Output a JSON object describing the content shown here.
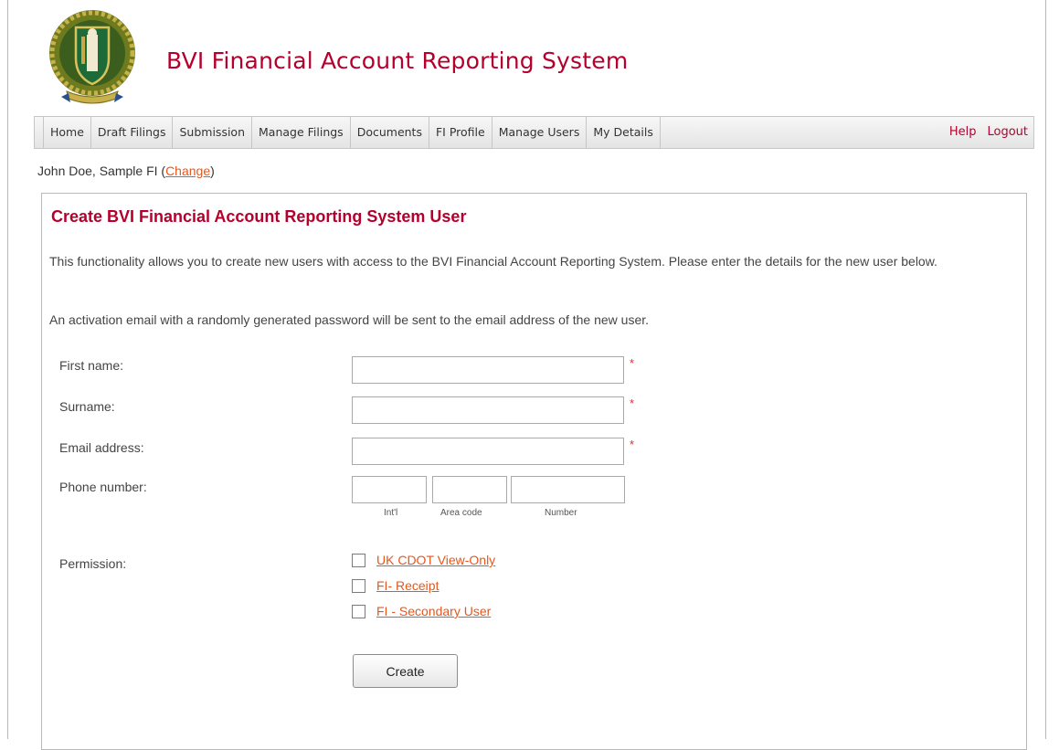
{
  "header": {
    "title": "BVI Financial Account Reporting System",
    "crest_icon": "bvi-coat-of-arms-icon",
    "colors": {
      "brand": "#b5002d",
      "link": "#e8561a",
      "required": "#e0302b"
    }
  },
  "nav": {
    "items": [
      {
        "label": "Home"
      },
      {
        "label": "Draft Filings"
      },
      {
        "label": "Submission"
      },
      {
        "label": "Manage Filings"
      },
      {
        "label": "Documents"
      },
      {
        "label": "FI Profile"
      },
      {
        "label": "Manage Users"
      },
      {
        "label": "My Details"
      }
    ],
    "help": "Help",
    "logout": "Logout"
  },
  "user": {
    "prefix": "John Doe, Sample FI (",
    "change": "Change",
    "suffix": ")"
  },
  "form": {
    "title": "Create BVI Financial Account Reporting System User",
    "intro": "This functionality allows you to create new users with access to the BVI Financial Account Reporting System. Please enter the details for the new user below.",
    "note": "An activation email with a randomly generated password will be sent to the email address of the new user.",
    "first_name": {
      "label": "First name:",
      "value": ""
    },
    "surname": {
      "label": "Surname:",
      "value": ""
    },
    "email": {
      "label": "Email address:",
      "value": ""
    },
    "phone": {
      "label": "Phone number:",
      "intl_label": "Int'l",
      "area_label": "Area code",
      "number_label": "Number",
      "intl": "",
      "area": "",
      "number": ""
    },
    "required_mark": "*",
    "permission": {
      "label": "Permission:",
      "options": [
        {
          "label": "UK CDOT View-Only",
          "checked": false
        },
        {
          "label": "FI- Receipt",
          "checked": false
        },
        {
          "label": "FI - Secondary User",
          "checked": false
        }
      ]
    },
    "create_button": "Create"
  }
}
